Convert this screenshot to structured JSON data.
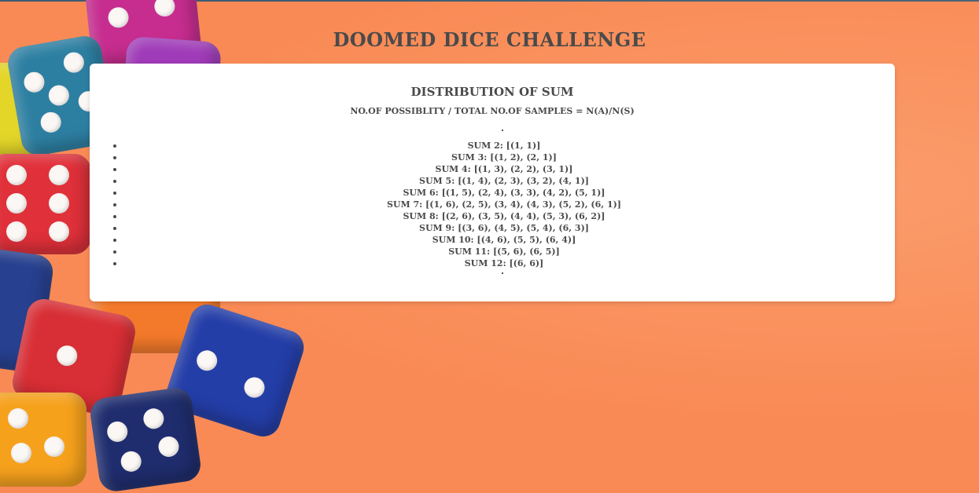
{
  "header": {
    "title": "DOOMED DICE CHALLENGE"
  },
  "card": {
    "title": "DISTRIBUTION OF SUM",
    "subtitle": "NO.OF POSSIBLITY / TOTAL NO.OF SAMPLES = N(A)/N(S)",
    "sums": [
      "SUM 2: [(1, 1)]",
      "SUM 3: [(1, 2), (2, 1)]",
      "SUM 4: [(1, 3), (2, 2), (3, 1)]",
      "SUM 5: [(1, 4), (2, 3), (3, 2), (4, 1)]",
      "SUM 6: [(1, 5), (2, 4), (3, 3), (4, 2), (5, 1)]",
      "SUM 7: [(1, 6), (2, 5), (3, 4), (4, 3), (5, 2), (6, 1)]",
      "SUM 8: [(2, 6), (3, 5), (4, 4), (5, 3), (6, 2)]",
      "SUM 9: [(3, 6), (4, 5), (5, 4), (6, 3)]",
      "SUM 10: [(4, 6), (5, 5), (6, 4)]",
      "SUM 11: [(5, 6), (6, 5)]",
      "SUM 12: [(6, 6)]"
    ]
  },
  "background": {
    "color": "#f98a55",
    "image": "colorful-dice-photo"
  }
}
